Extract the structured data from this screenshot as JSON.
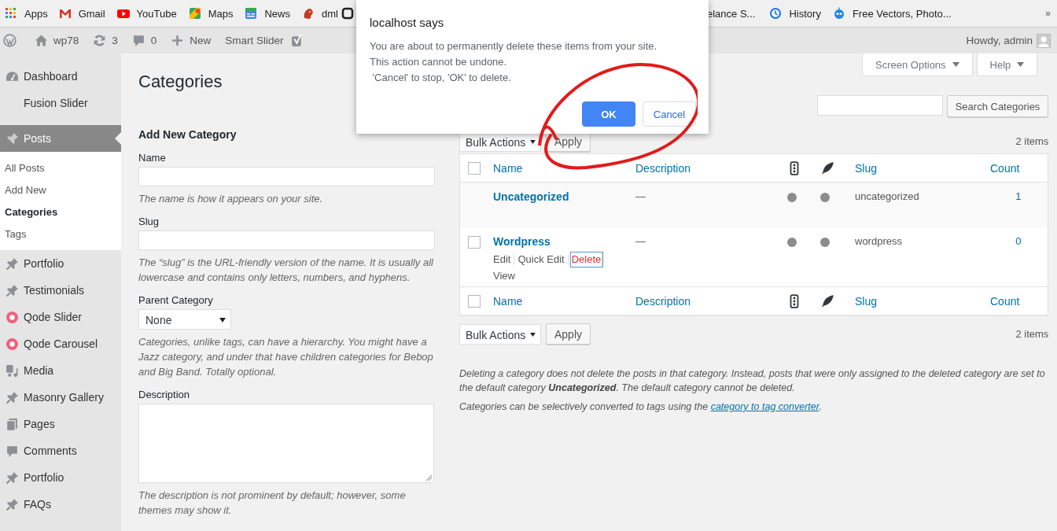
{
  "browser": {
    "bookmarks_left": [
      {
        "label": "Apps"
      },
      {
        "label": "Gmail"
      },
      {
        "label": "YouTube"
      },
      {
        "label": "Maps"
      },
      {
        "label": "News"
      },
      {
        "label": "dml"
      }
    ],
    "bookmarks_right": [
      {
        "label": "elance S..."
      },
      {
        "label": "History"
      },
      {
        "label": "Free Vectors, Photo..."
      }
    ],
    "more": "»"
  },
  "admin_bar": {
    "items": [
      {
        "label": "wp78"
      },
      {
        "label": "3"
      },
      {
        "label": "0"
      },
      {
        "label": "New"
      },
      {
        "label": "Smart Slider"
      }
    ],
    "greeting": "Howdy, admin"
  },
  "sidebar": {
    "items": [
      {
        "label": "Dashboard",
        "selected": false
      },
      {
        "label": "Fusion Slider",
        "selected": false
      },
      {
        "label": "Posts",
        "selected": true,
        "children": [
          {
            "label": "All Posts",
            "selected": false
          },
          {
            "label": "Add New",
            "selected": false
          },
          {
            "label": "Categories",
            "selected": true
          },
          {
            "label": "Tags",
            "selected": false
          }
        ]
      },
      {
        "label": "Portfolio",
        "selected": false
      },
      {
        "label": "Testimonials",
        "selected": false
      },
      {
        "label": "Qode Slider",
        "selected": false
      },
      {
        "label": "Qode Carousel",
        "selected": false
      },
      {
        "label": "Media",
        "selected": false
      },
      {
        "label": "Masonry Gallery",
        "selected": false
      },
      {
        "label": "Pages",
        "selected": false
      },
      {
        "label": "Comments",
        "selected": false
      },
      {
        "label": "Portfolio",
        "selected": false
      },
      {
        "label": "FAQs",
        "selected": false
      }
    ]
  },
  "page": {
    "title": "Categories",
    "screen_tabs": [
      "Screen Options",
      "Help"
    ],
    "search_button": "Search Categories"
  },
  "form": {
    "heading": "Add New Category",
    "fields": [
      {
        "kind": "input",
        "label": "Name",
        "hint": "The name is how it appears on your site."
      },
      {
        "kind": "input",
        "label": "Slug",
        "hint": "The “slug” is the URL-friendly version of the name. It is usually all lowercase and contains only letters, numbers, and hyphens."
      },
      {
        "kind": "select",
        "label": "Parent Category",
        "value": "None",
        "hint": "Categories, unlike tags, can have a hierarchy. You might have a Jazz category, and under that have children categories for Bebop and Big Band. Totally optional."
      },
      {
        "kind": "textarea",
        "label": "Description",
        "hint": "The description is not prominent by default; however, some themes may show it."
      }
    ]
  },
  "list": {
    "top_bar": {
      "bulk": "Bulk Actions",
      "apply": "Apply",
      "count": "2 items"
    },
    "header": [
      {
        "kind": "check",
        "checked": false
      },
      {
        "kind": "text",
        "label": "Name"
      },
      {
        "kind": "text",
        "label": "Description"
      },
      {
        "kind": "icon"
      },
      {
        "kind": "icon"
      },
      {
        "kind": "text",
        "label": "Slug"
      },
      {
        "kind": "text",
        "label": "Count"
      }
    ],
    "rows": [
      {
        "name": "Uncategorized",
        "description": "—",
        "slug": "uncategorized",
        "count": "1"
      },
      {
        "checked": false,
        "name": "Wordpress",
        "description": "—",
        "slug": "wordpress",
        "count": "0",
        "actions": [
          {
            "label": "Edit",
            "kind": "normal"
          },
          {
            "label": "Quick Edit",
            "kind": "normal"
          },
          {
            "label": "Delete",
            "kind": "danger",
            "focused": true
          },
          {
            "label": "View",
            "kind": "normal"
          }
        ]
      }
    ],
    "footer": [
      {
        "kind": "check",
        "checked": false
      },
      {
        "kind": "text",
        "label": "Name"
      },
      {
        "kind": "text",
        "label": "Description"
      },
      {
        "kind": "icon"
      },
      {
        "kind": "icon"
      },
      {
        "kind": "text",
        "label": "Slug"
      },
      {
        "kind": "text",
        "label": "Count"
      }
    ],
    "bottom_bar": {
      "bulk": "Bulk Actions",
      "apply": "Apply",
      "count": "2 items"
    },
    "notes": [
      {
        "text": "Deleting a category does not delete the posts in that category. Instead, posts that were only assigned to the deleted category are set to the default category **Uncategorized**. The default category cannot be deleted."
      },
      {
        "text": "Categories can be selectively converted to tags using the",
        "link": "category to tag converter",
        "after": "."
      }
    ]
  },
  "dialog": {
    "title": "localhost says",
    "lines": [
      "You are about to permanently delete these items from your site.",
      "This action cannot be undone.",
      " 'Cancel' to stop, 'OK' to delete."
    ],
    "buttons": [
      {
        "label": "OK",
        "kind": "primary"
      },
      {
        "label": "Cancel",
        "kind": "secondary"
      }
    ]
  }
}
